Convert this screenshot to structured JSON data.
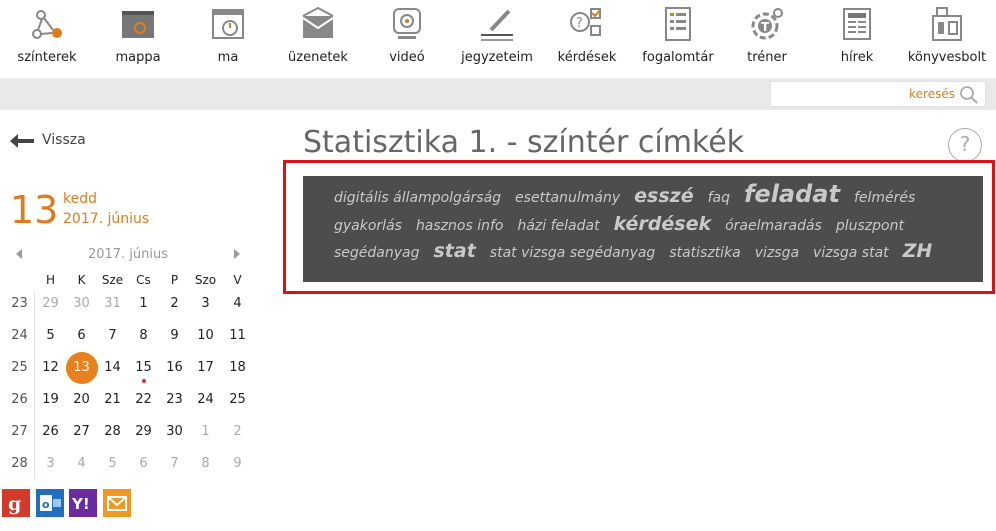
{
  "nav": [
    {
      "label": "színterek",
      "icon": "network-icon"
    },
    {
      "label": "mappa",
      "icon": "folder-icon"
    },
    {
      "label": "ma",
      "icon": "calendar-clock-icon"
    },
    {
      "label": "üzenetek",
      "icon": "envelope-icon"
    },
    {
      "label": "videó",
      "icon": "webcam-icon"
    },
    {
      "label": "jegyzeteim",
      "icon": "pencil-icon"
    },
    {
      "label": "kérdések",
      "icon": "question-checklist-icon"
    },
    {
      "label": "fogalomtár",
      "icon": "glossary-icon"
    },
    {
      "label": "tréner",
      "icon": "trainer-gear-icon"
    },
    {
      "label": "hírek",
      "icon": "newspaper-icon"
    },
    {
      "label": "könyvesbolt",
      "icon": "bookstore-icon"
    }
  ],
  "search": {
    "label": "keresés",
    "placeholder": ""
  },
  "back_label": "Vissza",
  "date": {
    "day": "13",
    "weekday": "kedd",
    "month": "2017. június"
  },
  "calendar": {
    "title": "2017. június",
    "headers": [
      "H",
      "K",
      "Sze",
      "Cs",
      "P",
      "Szo",
      "V"
    ],
    "weeks": [
      {
        "wk": "23",
        "days": [
          "29",
          "30",
          "31",
          "1",
          "2",
          "3",
          "4"
        ]
      },
      {
        "wk": "24",
        "days": [
          "5",
          "6",
          "7",
          "8",
          "9",
          "10",
          "11"
        ]
      },
      {
        "wk": "25",
        "days": [
          "12",
          "13",
          "14",
          "15",
          "16",
          "17",
          "18"
        ]
      },
      {
        "wk": "26",
        "days": [
          "19",
          "20",
          "21",
          "22",
          "23",
          "24",
          "25"
        ]
      },
      {
        "wk": "27",
        "days": [
          "26",
          "27",
          "28",
          "29",
          "30",
          "1",
          "2"
        ]
      },
      {
        "wk": "28",
        "days": [
          "3",
          "4",
          "5",
          "6",
          "7",
          "8",
          "9"
        ]
      }
    ],
    "current_day": "13",
    "event_day": "15"
  },
  "page_title": "Statisztika 1. - színtér címkék",
  "help_label": "?",
  "tags": [
    {
      "text": "digitális állampolgárság",
      "weight": 1
    },
    {
      "text": "esettanulmány",
      "weight": 1
    },
    {
      "text": "esszé",
      "weight": 3
    },
    {
      "text": "faq",
      "weight": 1
    },
    {
      "text": "feladat",
      "weight": 4
    },
    {
      "text": "felmérés",
      "weight": 1
    },
    {
      "text": "gyakorlás",
      "weight": 1
    },
    {
      "text": "hasznos info",
      "weight": 1
    },
    {
      "text": "házi feladat",
      "weight": 1
    },
    {
      "text": "kérdések",
      "weight": 3
    },
    {
      "text": "óraelmaradás",
      "weight": 1
    },
    {
      "text": "pluszpont",
      "weight": 1
    },
    {
      "text": "segédanyag",
      "weight": 1
    },
    {
      "text": "stat",
      "weight": 3
    },
    {
      "text": "stat vizsga segédanyag",
      "weight": 1
    },
    {
      "text": "statisztika",
      "weight": 1
    },
    {
      "text": "vizsga",
      "weight": 1
    },
    {
      "text": "vizsga stat",
      "weight": 1
    },
    {
      "text": "ZH",
      "weight": 3
    }
  ],
  "colors": {
    "accent": "#e07b1a",
    "highlight_frame": "#d91414",
    "cloud_bg": "#4d4d4d"
  }
}
